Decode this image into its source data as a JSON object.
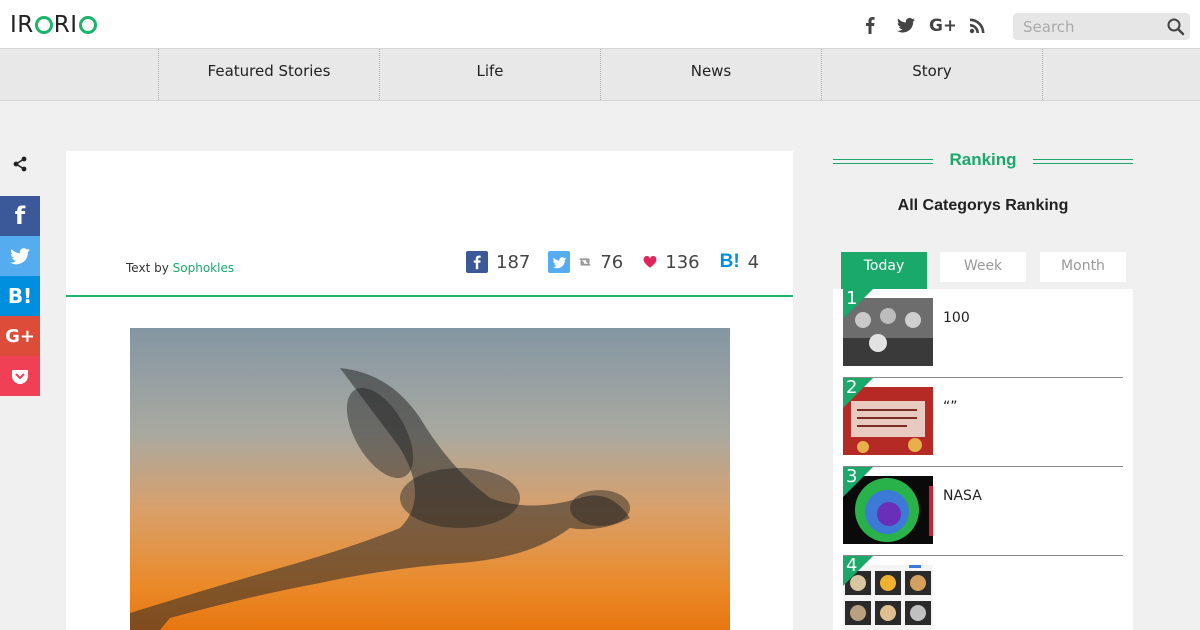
{
  "header": {
    "logo_text": "IRORIO",
    "logo_parts": [
      "IR",
      "R",
      "I"
    ],
    "social": [
      "facebook-icon",
      "twitter-icon",
      "google-plus-icon",
      "rss-icon"
    ],
    "search_placeholder": "Search"
  },
  "nav": {
    "items": [
      {
        "label": "Featured Stories"
      },
      {
        "label": "Life"
      },
      {
        "label": "News"
      },
      {
        "label": "Story"
      }
    ]
  },
  "share_bar": {
    "buttons": [
      {
        "name": "facebook",
        "label": "f",
        "color": "#3b5998"
      },
      {
        "name": "twitter",
        "label": "",
        "color": "#55acee"
      },
      {
        "name": "hatena",
        "label": "B!",
        "color": "#008fde"
      },
      {
        "name": "google-plus",
        "label": "G+",
        "color": "#dd4b39"
      },
      {
        "name": "pocket",
        "label": "",
        "color": "#ef4056"
      }
    ]
  },
  "article": {
    "byline_prefix": "Text by",
    "author": "Sophokles",
    "counts": {
      "facebook": "187",
      "retweets": "76",
      "likes": "136",
      "hatena": "4"
    }
  },
  "sidebar": {
    "ranking_title": "Ranking",
    "ranking_subtitle": "All Categorys Ranking",
    "tabs": [
      {
        "label": "Today",
        "active": true
      },
      {
        "label": "Week",
        "active": false
      },
      {
        "label": "Month",
        "active": false
      }
    ],
    "items": [
      {
        "rank": "1",
        "title": "100"
      },
      {
        "rank": "2",
        "title": "“”"
      },
      {
        "rank": "3",
        "title": "NASA"
      },
      {
        "rank": "4",
        "title": ""
      }
    ]
  },
  "colors": {
    "accent": "#1aa86b",
    "nav_bg": "#e8e8e8",
    "page_bg": "#f0f0f0"
  }
}
